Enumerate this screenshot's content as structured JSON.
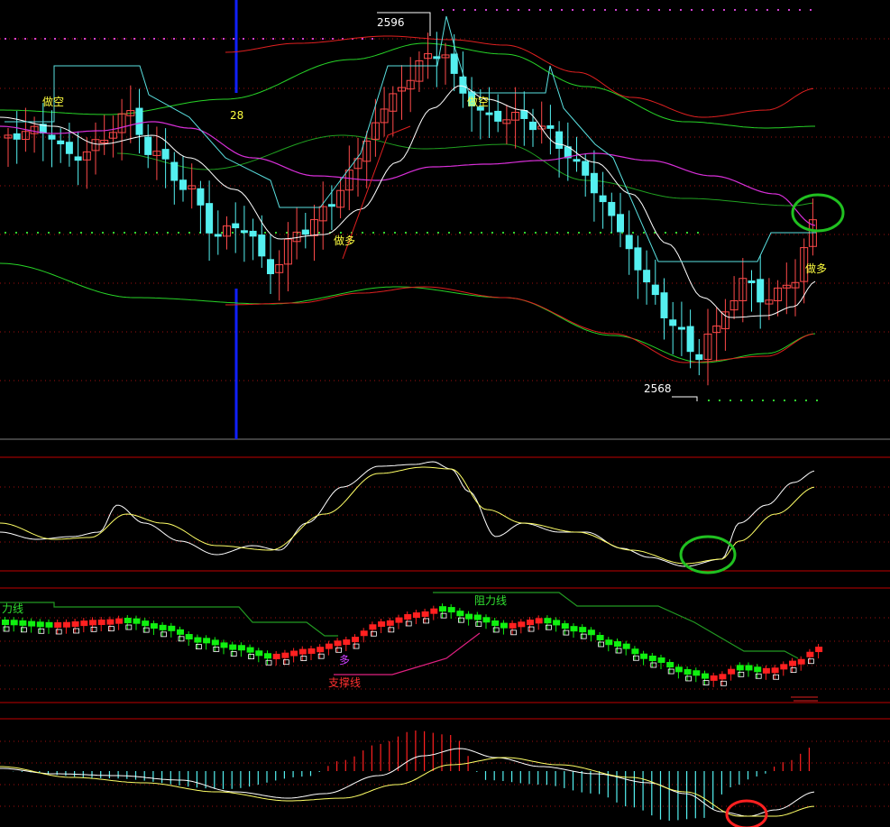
{
  "colors": {
    "background": "#000000",
    "bull": "#ff4a4a",
    "bear": "#54f0f0",
    "green_band": "#27d327",
    "red_band": "#e02020",
    "magenta_ma": "#d82fd8",
    "white_ma": "#ffffff",
    "cyan_step": "#5ae0e0",
    "yellow": "#ffff66",
    "pane_border": "#c00000",
    "grid_dot": "#a01010",
    "blue_marker": "#1020ff",
    "circle_green": "#20c020",
    "circle_red": "#ff2020",
    "osc_bull": "#ff2020",
    "osc_bear": "#10f010",
    "sr_line": "#229922",
    "support_line": "#e02080",
    "label_yellow": "#ffff40",
    "label_green": "#30e030",
    "label_red": "#ff3030",
    "label_purple": "#cc40ff"
  },
  "labels": {
    "high_price": "2596",
    "low_price": "2568",
    "marker_value": "28",
    "short_signal": "做空",
    "long_signal": "做多",
    "resistance": "阻力线",
    "resistance_partial": "力线",
    "support": "支撑线",
    "long_small": "多"
  },
  "chart_data": {
    "type": "candlestick",
    "panes": [
      "price",
      "oscillator",
      "support_resistance",
      "macd"
    ],
    "annotations": {
      "high": 2596,
      "low": 2568,
      "counter": 28
    }
  }
}
